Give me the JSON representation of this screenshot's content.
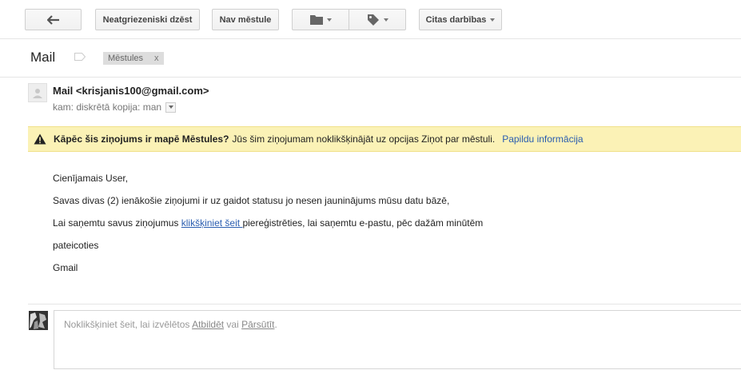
{
  "toolbar": {
    "not_spam_label": "Neatgriezeniski dzēst",
    "move_out_label": "Nav mēstule",
    "more_label": "Citas darbības"
  },
  "message": {
    "subject": "Mail",
    "label_chip": "Mēstules",
    "label_chip_remove": "x",
    "sender": "Mail <krisjanis100@gmail.com>",
    "recipient": "kam: diskrētā kopija: man"
  },
  "warning": {
    "title": "Kāpēc šis ziņojums ir mapē Mēstules?",
    "text": "Jūs šim ziņojumam noklikšķinājāt uz opcijas Ziņot par mēstuli.",
    "link": "Papildu informācija"
  },
  "body": {
    "greeting": "Cienījamais User,",
    "line1": "Savas divas (2) ienākošie ziņojumi ir uz gaidot statusu jo nesen jauninājums mūsu datu bāzē,",
    "line2_before": "Lai saņemtu savus ziņojumus ",
    "line2_link": "klikšķiniet šeit ",
    "line2_after": "piereģistrēties, lai saņemtu e-pastu, pēc dažām minūtēm",
    "closing": "pateicoties",
    "signature": "Gmail"
  },
  "reply": {
    "prefix": "Noklikšķiniet šeit, lai izvēlētos ",
    "reply_link": "Atbildēt",
    "middle": " vai ",
    "forward_link": "Pārsūtīt",
    "suffix": "."
  },
  "icons": {
    "back": "arrow-left-icon",
    "folder": "folder-icon",
    "label": "label-tag-icon",
    "warning": "warning-triangle-icon"
  }
}
